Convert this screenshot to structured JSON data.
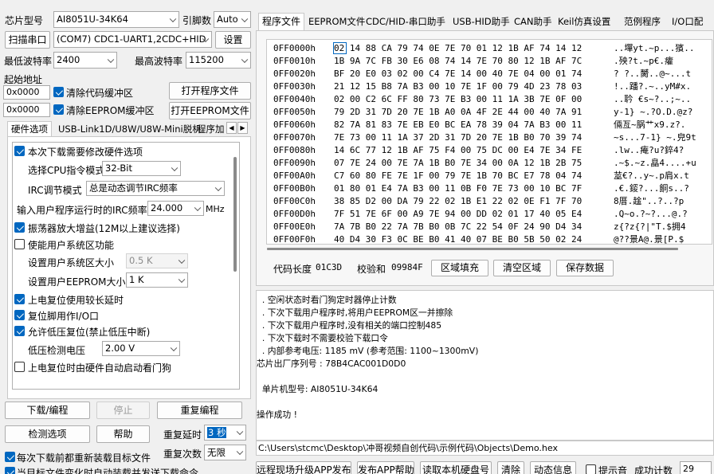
{
  "left": {
    "chip_label": "芯片型号",
    "chip_value": "AI8051U-34K64",
    "pin_label": "引脚数",
    "pin_value": "Auto",
    "scan_button": "扫描串口",
    "port_value": "(COM7) CDC1-UART1,2CDC+HID",
    "settings_button": "设置",
    "min_baud_label": "最低波特率",
    "min_baud_value": "2400",
    "max_baud_label": "最高波特率",
    "max_baud_value": "115200",
    "start_addr_label": "起始地址",
    "addr1": "0x0000",
    "addr2": "0x0000",
    "clear_code_label": "清除代码缓冲区",
    "clear_eeprom_label": "清除EEPROM缓冲区",
    "open_prog_button": "打开程序文件",
    "open_eeprom_button": "打开EEPROM文件",
    "tabs": [
      "硬件选项",
      "USB-Link1D/U8W/U8W-Mini脱机",
      "程序加"
    ],
    "opt_modify_hw": "本次下载需要修改硬件选项",
    "cpu_mode_label": "选择CPU指令模式",
    "cpu_mode_value": "32-Bit",
    "irc_mode_label": "IRC调节模式",
    "irc_mode_value": "总是动态调节IRC频率",
    "irc_freq_label": "输入用户程序运行时的IRC频率",
    "irc_freq_value": "24.000",
    "irc_freq_unit": "MHz",
    "opt_osc_gain": "振荡器放大增益(12M以上建议选择)",
    "opt_user_sys": "使能用户系统区功能",
    "user_sys_size_label": "设置用户系统区大小",
    "user_sys_size_value": "0.5 K",
    "user_eeprom_size_label": "设置用户EEPROM大小",
    "user_eeprom_size_value": "1   K",
    "opt_long_delay": "上电复位使用较长延时",
    "opt_reset_io": "复位脚用作I/O口",
    "opt_lvd_reset": "允许低压复位(禁止低压中断)",
    "lvd_label": "低压检测电压",
    "lvd_value": "2.00 V",
    "opt_wdt": "上电复位时由硬件自动启动看门狗",
    "download_button": "下载/编程",
    "stop_button": "停止",
    "reprogram_button": "重复编程",
    "check_button": "检测选项",
    "help_button": "帮助",
    "repeat_delay_label": "重复延时",
    "repeat_delay_value": "3 秒",
    "repeat_count_label": "重复次数",
    "repeat_count_value": "无限",
    "reload_label": "每次下载前都重新装载目标文件",
    "auto_send_label": "当目标文件变化时自动装载并发送下载命令"
  },
  "right": {
    "tabs": [
      "程序文件",
      "EEPROM文件",
      "CDC/HID-串口助手",
      "USB-HID助手",
      "CAN助手",
      "Keil仿真设置",
      "范例程序",
      "I/O口配"
    ],
    "hex_rows": [
      {
        "addr": "0FF0000h",
        "bytes": "02 14 88 CA 79 74 0E 7E 70 01 12 1B AF 74 14 12",
        "ascii": "..墠yt.~p...獱.."
      },
      {
        "addr": "0FF0010h",
        "bytes": "1B 9A 7C FB 30 E6 08 74 14 7E 70 80 12 1B AF 7C",
        "ascii": ".殃?t.~p€.癨"
      },
      {
        "addr": "0FF0020h",
        "bytes": "BF 20 E0 03 02 00 C4 7E 14 00 40 7E 04 00 01 74",
        "ascii": "? ?..膥..@~...t"
      },
      {
        "addr": "0FF0030h",
        "bytes": "21 12 15 B8 7A B3 00 10 7E 1F 00 79 4D 23 78 03",
        "ascii": "!..蹯?.~..yM#x."
      },
      {
        "addr": "0FF0040h",
        "bytes": "02 00 C2 6C FF 80 73 7E B3 00 11 1A 3B 7E 0F 00",
        "ascii": "..耹 €s~?..;~.."
      },
      {
        "addr": "0FF0050h",
        "bytes": "79 2D 31 7D 20 7E 1B A0 0A 4F 2E 44 00 40 7A 91",
        "ascii": "y-1} ~.?O.D.@z?"
      },
      {
        "addr": "0FF0060h",
        "bytes": "82 7A 81 83 7E EB E0 BC EA 78 39 04 7A B3 00 11",
        "ascii": "倆亙~脶艹x9.z?."
      },
      {
        "addr": "0FF0070h",
        "bytes": "7E 73 00 11 1A 37 2D 31 7D 20 7E 1B B0 70 39 74",
        "ascii": "~s...7-1} ~.皃9t"
      },
      {
        "addr": "0FF0080h",
        "bytes": "14 6C 77 12 1B AF 75 F4 00 75 DC 00 E4 7E 34 FE",
        "ascii": ".lw..痷?u?錊4?"
      },
      {
        "addr": "0FF0090h",
        "bytes": "07 7E 24 00 7E 7A 1B B0 7E 34 00 0A 12 1B 2B 75",
        "ascii": ".~$.~z.皛4....+u"
      },
      {
        "addr": "0FF00A0h",
        "bytes": "C7 60 80 FE 7E 1F 00 79 7E 1B 70 BC E7 78 04 74",
        "ascii": "莁€?..y~.p肩x.t"
      },
      {
        "addr": "0FF00B0h",
        "bytes": "01 80 01 E4 7A B3 00 11 0B F0 7E 73 00 10 BC 7F",
        "ascii": ".€.錽?...餇s..?"
      },
      {
        "addr": "0FF00C0h",
        "bytes": "38 85 D2 00 DA 79 22 02 1B E1 22 02 0E F1 7F 70",
        "ascii": "8厝.趛\"..?..?p"
      },
      {
        "addr": "0FF00D0h",
        "bytes": "7F 51 7E 6F 00 A9 7E 94 00 DD 02 01 17 40 05 E4",
        "ascii": ".Q~o.?~?...@.?"
      },
      {
        "addr": "0FF00E0h",
        "bytes": "7A 7B B0 22 7A 7B B0 0B 7C 22 54 0F 24 90 D4 34",
        "ascii": "z{?z{?|\"T.$拥4"
      },
      {
        "addr": "0FF00F0h",
        "bytes": "40 D4 30 F3 0C BE B0 41 40 07 BE B0 5B 50 02 24",
        "ascii": "@??景A@.景[P.$"
      }
    ],
    "code_len_label": "代码长度",
    "code_len_value": "01C3D",
    "checksum_label": "校验和",
    "checksum_value": "09984F",
    "fill_button": "区域填充",
    "clear_button": "清空区域",
    "save_button": "保存数据",
    "log_lines": [
      "  . 空闲状态时看门狗定时器停止计数",
      "  . 下次下载用户程序时,将用户EEPROM区一并擦除",
      "  . 下次下载用户程序时,没有相关的端口控制485",
      "  . 下次下载时不需要校验下载口令",
      "  . 内部参考电压: 1185 mV (参考范围: 1100~1300mV)",
      "芯片出厂序列号 : 78B4CAC001D0D0",
      "",
      "  单片机型号: AI8051U-34K64",
      "",
      "操作成功 !"
    ],
    "file_path": "C:\\Users\\stcmc\\Desktop\\冲哥视频自创代码\\示例代码\\Objects\\Demo.hex",
    "bottom_buttons": [
      "远程现场升级APP发布",
      "发布APP帮助",
      "读取本机硬盘号",
      "清除",
      "动态信息"
    ],
    "tone_label": "提示音",
    "success_label": "成功计数",
    "success_value": "29"
  }
}
